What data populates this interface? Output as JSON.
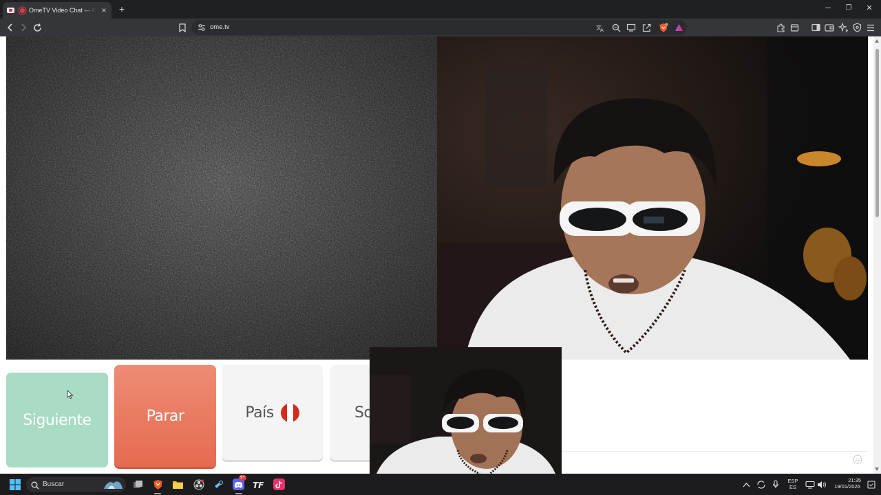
{
  "browser": {
    "tab": {
      "title": "OmeTV Video Chat — Omegle",
      "close_icon": "close-icon"
    },
    "new_tab_label": "+",
    "window_controls": {
      "minimize": "─",
      "restore": "❐",
      "close": "✕"
    },
    "url": "ome.tv",
    "toolbar_icons": [
      "back-icon",
      "forward-icon",
      "reload-icon",
      "bookmark-icon",
      "site-settings-icon",
      "translate-icon",
      "zoom-icon",
      "cast-icon",
      "share-icon",
      "brave-shields-icon",
      "brave-rewards-icon",
      "extensions-icon",
      "tab-search-icon",
      "sidebar-icon",
      "wallet-icon",
      "leo-ai-icon",
      "vpn-icon",
      "menu-icon"
    ]
  },
  "page": {
    "buttons": {
      "next_label": "Siguiente",
      "stop_label": "Parar",
      "country_label": "País",
      "sex_label_partial": "So"
    },
    "country_flag": {
      "name": "flag-peru",
      "colors": [
        "#d52b1e",
        "#ffffff"
      ]
    },
    "colors": {
      "next": "#a8dcc4",
      "stop": "#e56b50",
      "neutral": "#f4f4f4"
    }
  },
  "taskbar": {
    "search_placeholder": "Buscar",
    "apps": [
      "windows-start-icon",
      "search-icon",
      "task-view-icon",
      "brave-browser-icon",
      "file-explorer-icon",
      "obs-icon",
      "steam-icon",
      "discord-icon",
      "tf-icon",
      "tiktok-icon"
    ],
    "discord_badge": "9+",
    "tray": {
      "language_line1": "ESP",
      "language_line2": "ES",
      "time": "21:35",
      "date": "19/01/2026"
    }
  }
}
